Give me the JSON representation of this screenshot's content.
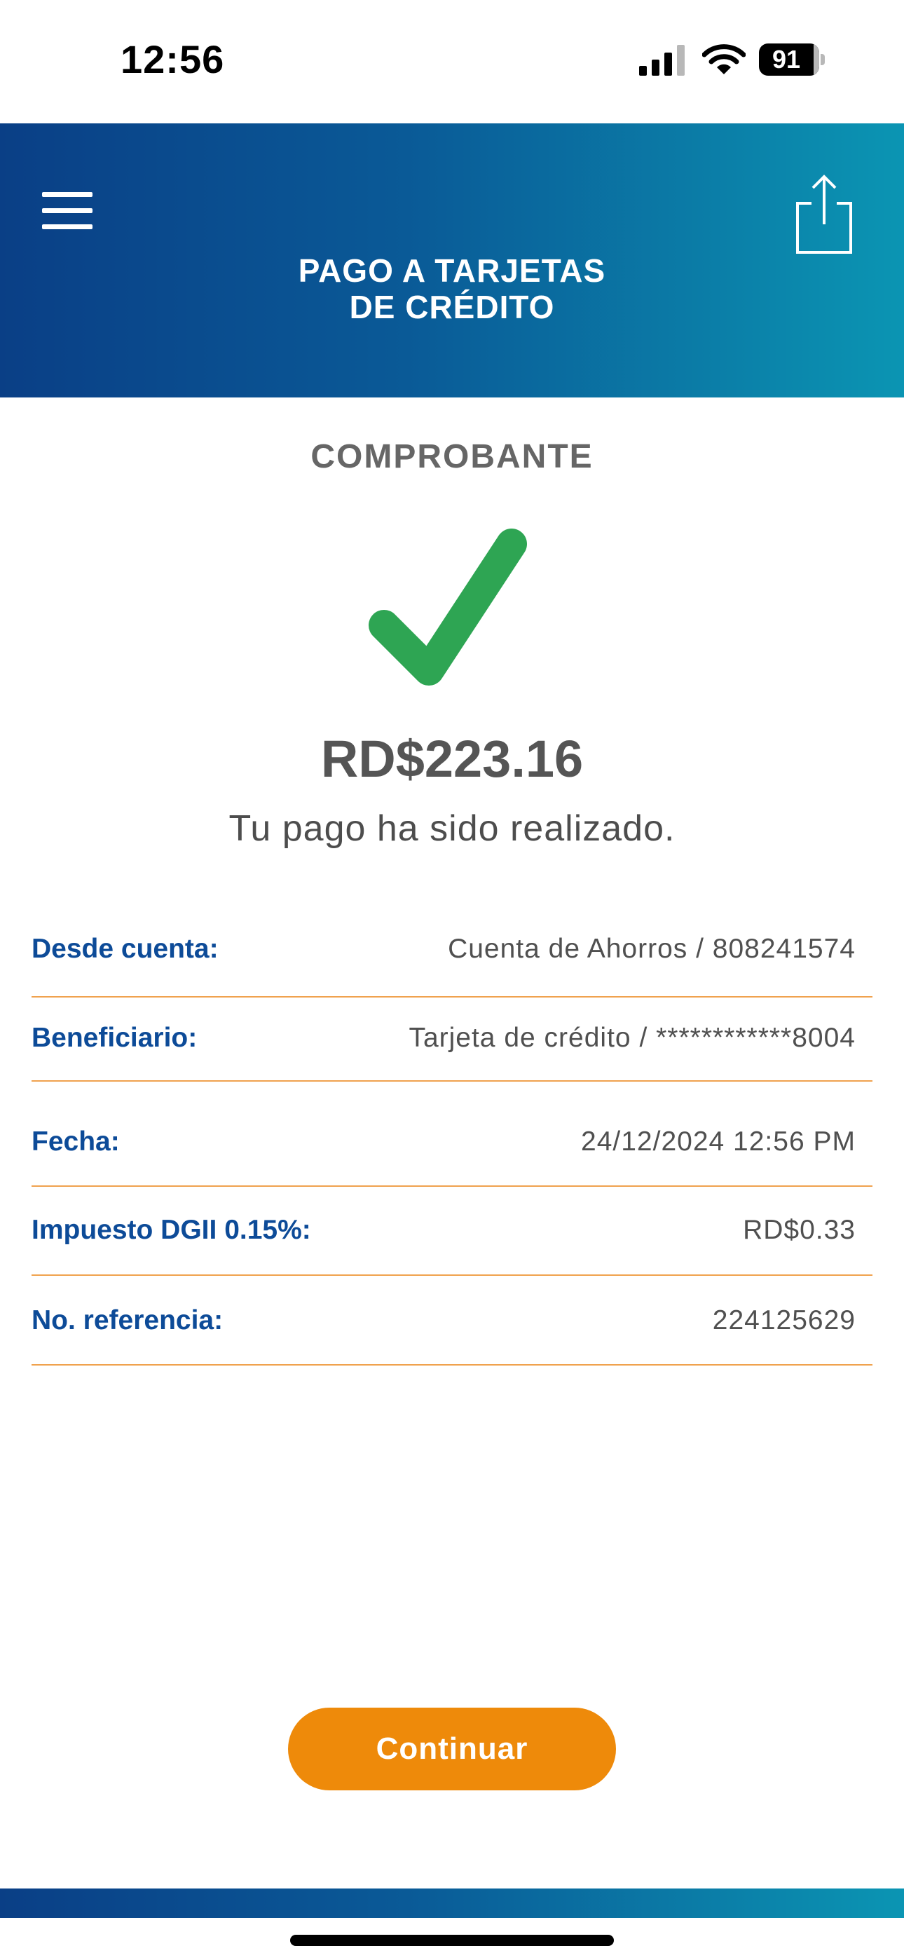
{
  "status_bar": {
    "time": "12:56",
    "battery_level": "91",
    "icons": [
      "signal-icon",
      "wifi-icon",
      "battery-icon"
    ]
  },
  "header": {
    "title_line1": "PAGO A TARJETAS",
    "title_line2": "DE CRÉDITO",
    "icons": [
      "menu-icon",
      "share-icon"
    ]
  },
  "receipt": {
    "section_title": "COMPROBANTE",
    "amount": "RD$223.16",
    "message": "Tu pago ha sido realizado.",
    "icon": "check-icon"
  },
  "details": [
    {
      "label": "Desde cuenta:",
      "value": "Cuenta de Ahorros / 808241574"
    },
    {
      "label": "Beneficiario:",
      "value": "Tarjeta de crédito / ************8004"
    },
    {
      "label": "Fecha:",
      "value": "24/12/2024 12:56 PM"
    },
    {
      "label": "Impuesto DGII 0.15%:",
      "value": "RD$0.33"
    },
    {
      "label": "No. referencia:",
      "value": "224125629"
    }
  ],
  "actions": {
    "continue_label": "Continuar"
  },
  "colors": {
    "header_gradient_start": "#0a3f86",
    "header_gradient_end": "#0b95b3",
    "label_blue": "#0d4b98",
    "divider_orange": "#f0a24e",
    "button_orange": "#ee8a0a",
    "check_green": "#2ea553"
  }
}
